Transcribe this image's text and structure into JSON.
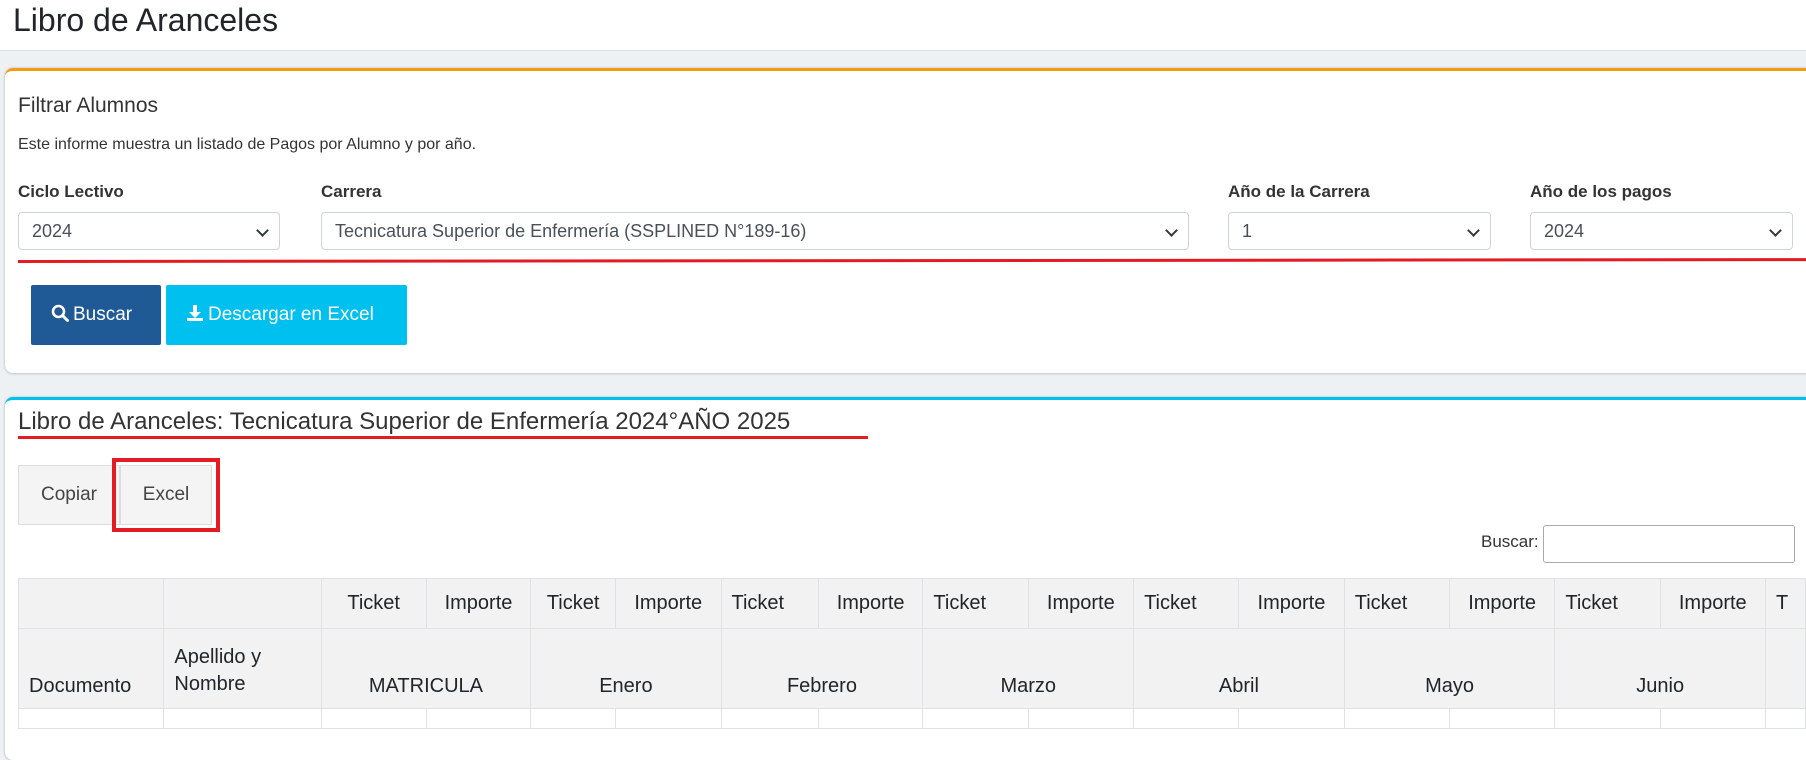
{
  "page": {
    "title": "Libro de Aranceles"
  },
  "filter": {
    "title": "Filtrar Alumnos",
    "description": "Este informe muestra un listado de Pagos por Alumno y por año.",
    "ciclo": {
      "label": "Ciclo Lectivo",
      "value": "2024"
    },
    "carrera": {
      "label": "Carrera",
      "value": "Tecnicatura Superior de Enfermería (SSPLINED N°189-16)"
    },
    "anio_carrera": {
      "label": "Año de la Carrera",
      "value": "1"
    },
    "anio_pagos": {
      "label": "Año de los pagos",
      "value": "2024"
    },
    "buscar_label": "Buscar",
    "excel_label": "Descargar en Excel"
  },
  "table_section": {
    "title": "Libro de Aranceles: Tecnicatura Superior de Enfermería 2024°AÑO 2025",
    "copy_label": "Copiar",
    "excel_label": "Excel",
    "search_label": "Buscar:",
    "header_row1": [
      "Ticket",
      "Importe",
      "Ticket",
      "Importe",
      "Ticket",
      "Importe",
      "Ticket",
      "Importe",
      "Ticket",
      "Importe",
      "Ticket",
      "Importe",
      "Ticket",
      "Importe",
      "T"
    ],
    "col_documento": "Documento",
    "col_apellido": "Apellido y Nombre",
    "groups": [
      "MATRICULA",
      "Enero",
      "Febrero",
      "Marzo",
      "Abril",
      "Mayo",
      "Junio"
    ]
  },
  "colors": {
    "primary": "#1f5a96",
    "info": "#00c0ef",
    "warning_border": "#f39c12",
    "annotation_red": "#e31b23"
  }
}
